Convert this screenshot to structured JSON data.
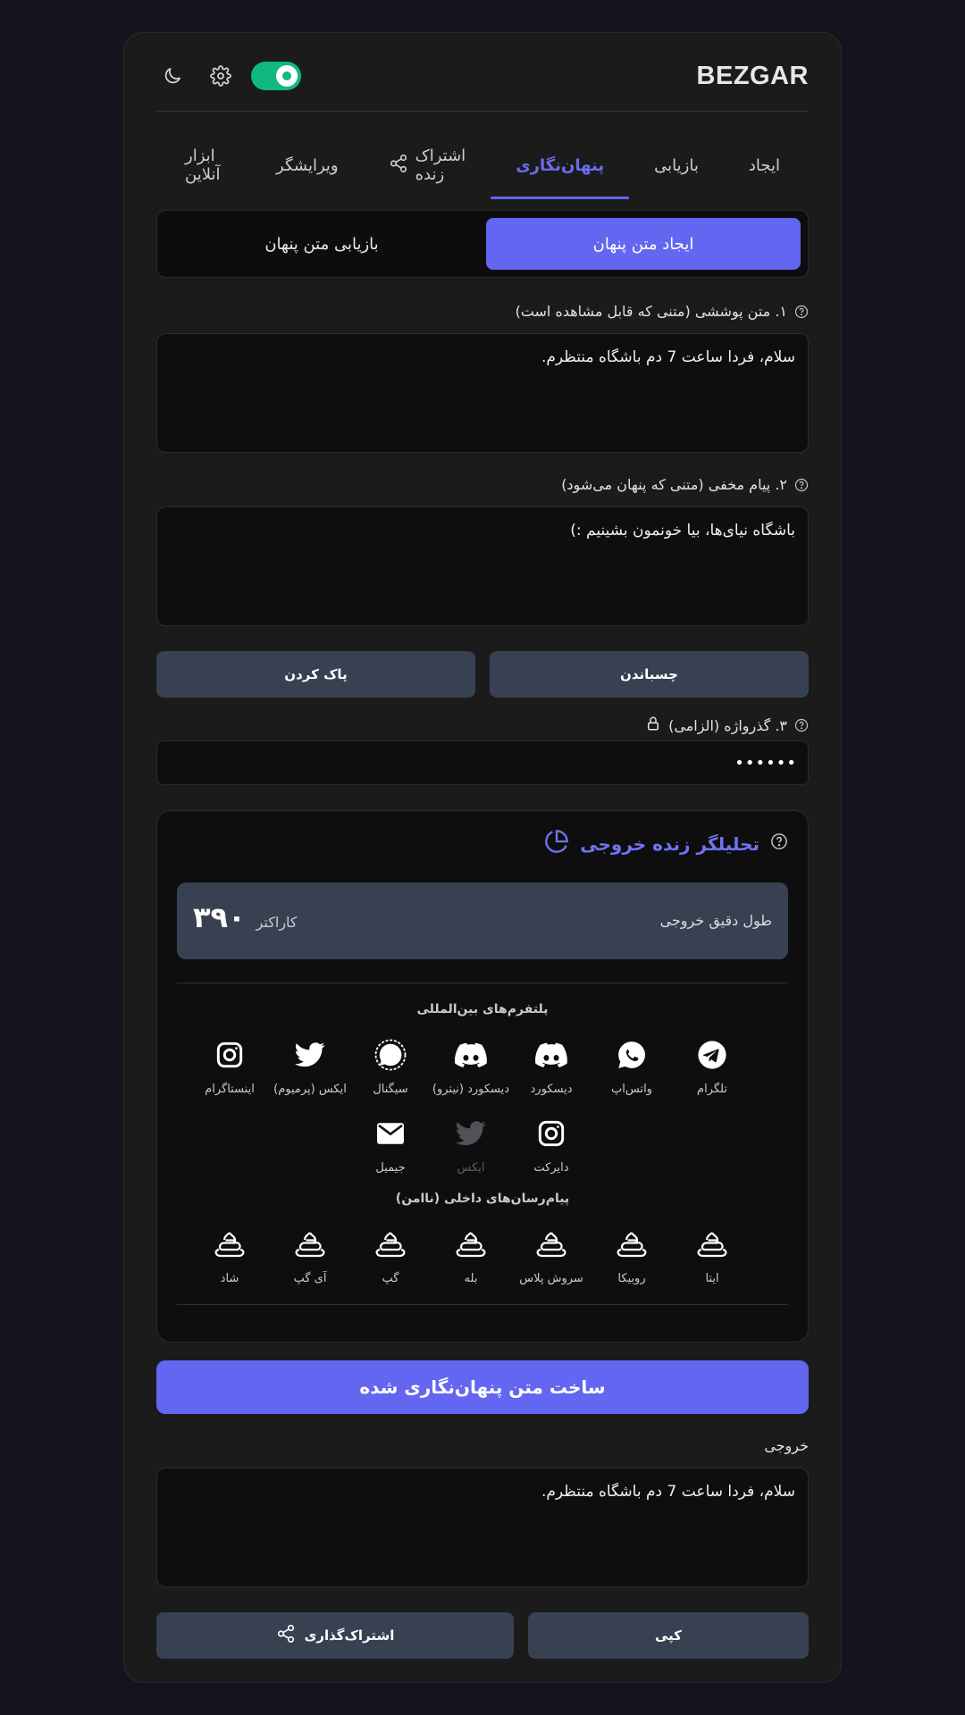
{
  "header": {
    "brand": "BEZGAR",
    "toggle_on": true,
    "icons": [
      "moon-icon",
      "gear-icon"
    ]
  },
  "tabs": [
    {
      "label": "ایجاد",
      "active": false
    },
    {
      "label": "بازیابی",
      "active": false
    },
    {
      "label": "پنهان‌نگاری",
      "active": true
    },
    {
      "label": "اشتراک زنده",
      "active": false,
      "icon": "share-icon"
    },
    {
      "label": "ویرایشگر",
      "active": false
    },
    {
      "label": "ابزار آنلاین",
      "active": false
    }
  ],
  "subtabs": {
    "create": "ایجاد متن پنهان",
    "recover": "بازیابی متن پنهان"
  },
  "cover": {
    "label": "۱. متن پوششی (متنی که قابل مشاهده است)",
    "value": "سلام، فردا ساعت 7 دم باشگاه منتظرم."
  },
  "secret": {
    "label": "۲. پیام مخفی (متنی که پنهان می‌شود)",
    "value": "باشگاه نیای‌ها، بیا خونمون بشینیم :)"
  },
  "actions": {
    "paste": "چسباندن",
    "clear": "پاک کردن"
  },
  "password": {
    "label": "۳. گذرواژه (الزامی)",
    "value": "••••••"
  },
  "analyzer": {
    "title": "تحلیلگر زنده خروجی",
    "length_label": "طول دقیق خروجی",
    "length_value": "۳۹۰",
    "length_unit": "کاراکتر",
    "international_title": "پلتفرم‌های بین‌المللی",
    "international": [
      {
        "name": "تلگرام",
        "icon": "telegram-icon",
        "ok": true
      },
      {
        "name": "واتس‌اپ",
        "icon": "whatsapp-icon",
        "ok": true
      },
      {
        "name": "دیسکورد",
        "icon": "discord-icon",
        "ok": true
      },
      {
        "name": "دیسکورد (نیترو)",
        "icon": "discord-icon",
        "ok": true
      },
      {
        "name": "سیگنال",
        "icon": "signal-icon",
        "ok": true
      },
      {
        "name": "ایکس (پرمیوم)",
        "icon": "twitter-icon",
        "ok": true
      },
      {
        "name": "اینستاگرام",
        "icon": "instagram-icon",
        "ok": true
      },
      {
        "name": "دایرکت",
        "icon": "instagram-icon",
        "ok": true
      },
      {
        "name": "ایکس",
        "icon": "twitter-icon",
        "ok": false
      },
      {
        "name": "جیمیل",
        "icon": "mail-icon",
        "ok": true
      }
    ],
    "domestic_title": "پیام‌رسان‌های داخلی (ناامن)",
    "domestic": [
      {
        "name": "ایتا",
        "icon": "poop-icon"
      },
      {
        "name": "روبیکا",
        "icon": "poop-icon"
      },
      {
        "name": "سروش پلاس",
        "icon": "poop-icon"
      },
      {
        "name": "بله",
        "icon": "poop-icon"
      },
      {
        "name": "گپ",
        "icon": "poop-icon"
      },
      {
        "name": "آی گپ",
        "icon": "poop-icon"
      },
      {
        "name": "شاد",
        "icon": "poop-icon"
      }
    ]
  },
  "build_button": "ساخت متن پنهان‌نگاری شده",
  "output": {
    "label": "خروجی",
    "value": "سلام، فردا ساعت 7 دم باشگاه منتظرم."
  },
  "bottom": {
    "copy": "کپی",
    "share": "اشتراک‌گذاری"
  },
  "colors": {
    "accent": "#6366f1",
    "toggle": "#10b981",
    "button_gray": "#374151",
    "background": "#14141f"
  }
}
